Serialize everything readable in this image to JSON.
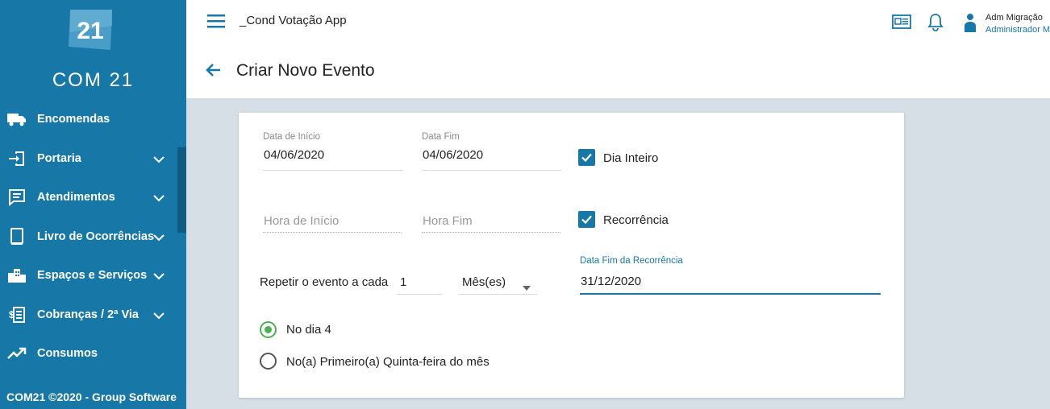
{
  "sidebar": {
    "logo_number": "21",
    "logo_text": "COM 21",
    "items": [
      {
        "label": "Encomendas",
        "icon": "truck-icon",
        "expandable": false
      },
      {
        "label": "Portaria",
        "icon": "login-door-icon",
        "expandable": true
      },
      {
        "label": "Atendimentos",
        "icon": "chat-icon",
        "expandable": true
      },
      {
        "label": "Livro de Ocorrências",
        "icon": "book-icon",
        "expandable": true
      },
      {
        "label": "Espaços e Serviços",
        "icon": "buildings-icon",
        "expandable": true
      },
      {
        "label": "Cobranças / 2ª Via",
        "icon": "billing-icon",
        "expandable": true
      },
      {
        "label": "Consumos",
        "icon": "trending-up-icon",
        "expandable": false
      }
    ],
    "footer": "COM21 ©2020 - Group Software"
  },
  "header": {
    "app_title": "_Cond Votação App",
    "user_name": "Adm Migração",
    "user_role": "Administrador M"
  },
  "page": {
    "title": "Criar Novo Evento"
  },
  "form": {
    "start_date_label": "Data de Início",
    "start_date_value": "04/06/2020",
    "end_date_label": "Data Fim",
    "end_date_value": "04/06/2020",
    "all_day_label": "Dia Inteiro",
    "all_day_checked": true,
    "start_time_placeholder": "Hora de Início",
    "end_time_placeholder": "Hora Fim",
    "recurrence_label": "Recorrência",
    "recurrence_checked": true,
    "repeat_label": "Repetir o evento a cada",
    "repeat_value": "1",
    "repeat_unit": "Mês(es)",
    "recurrence_end_label": "Data Fim da Recorrência",
    "recurrence_end_value": "31/12/2020",
    "option_day": "No dia 4",
    "option_day_selected": true,
    "option_weekday": "No(a) Primeiro(a) Quinta-feira do mês",
    "option_weekday_selected": false
  },
  "colors": {
    "sidebar": "#1777a6",
    "accent": "#1777a6",
    "radio_selected": "#4caf50",
    "background": "#d6dee6"
  }
}
